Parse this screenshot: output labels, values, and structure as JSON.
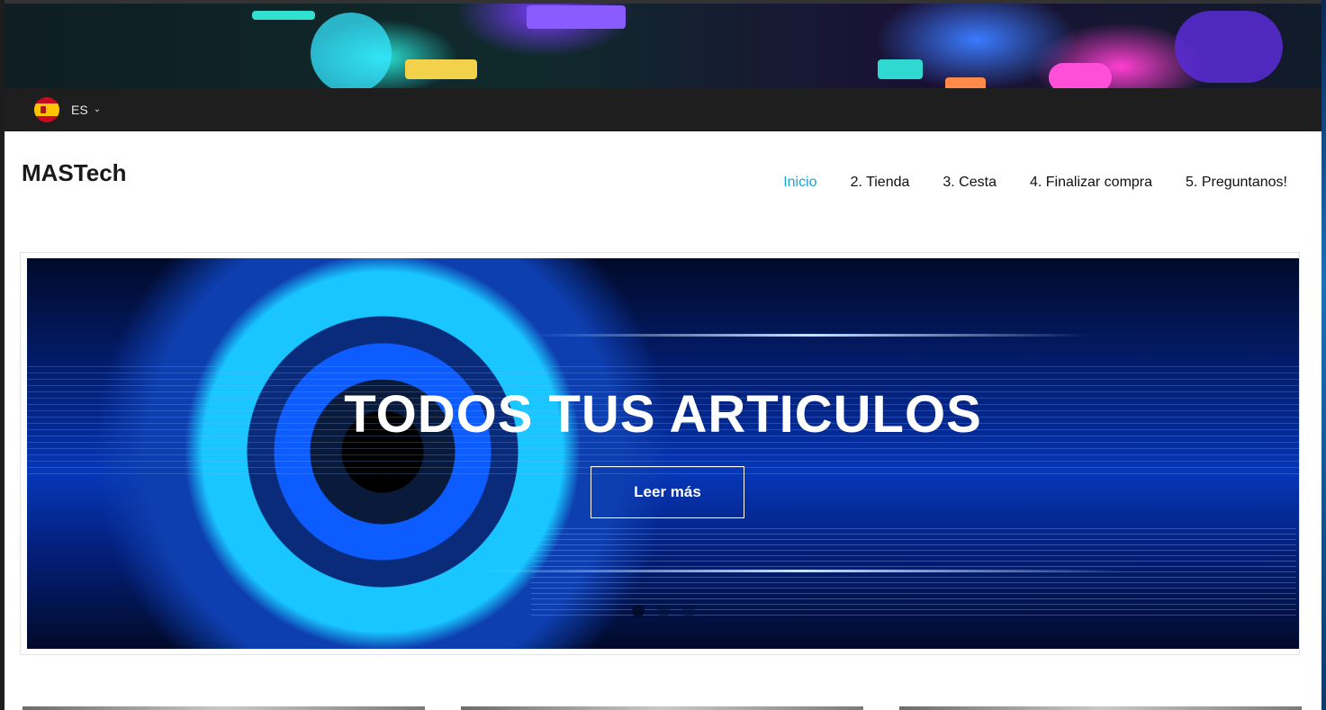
{
  "language": {
    "flag_icon": "spain-flag-icon",
    "code": "ES",
    "chevron": "⌄"
  },
  "site": {
    "title": "MASTech"
  },
  "nav": {
    "items": [
      {
        "label": "Inicio",
        "active": true
      },
      {
        "label": "2. Tienda",
        "active": false
      },
      {
        "label": "3. Cesta",
        "active": false
      },
      {
        "label": "4. Finalizar compra",
        "active": false
      },
      {
        "label": "5. Preguntanos!",
        "active": false
      }
    ]
  },
  "slider": {
    "title": "TODOS TUS ARTICULOS",
    "button_label": "Leer más",
    "dots_count": 3,
    "active_dot": 1
  },
  "colors": {
    "accent": "#17a2d8",
    "lang_bar": "#1e1e1e"
  }
}
